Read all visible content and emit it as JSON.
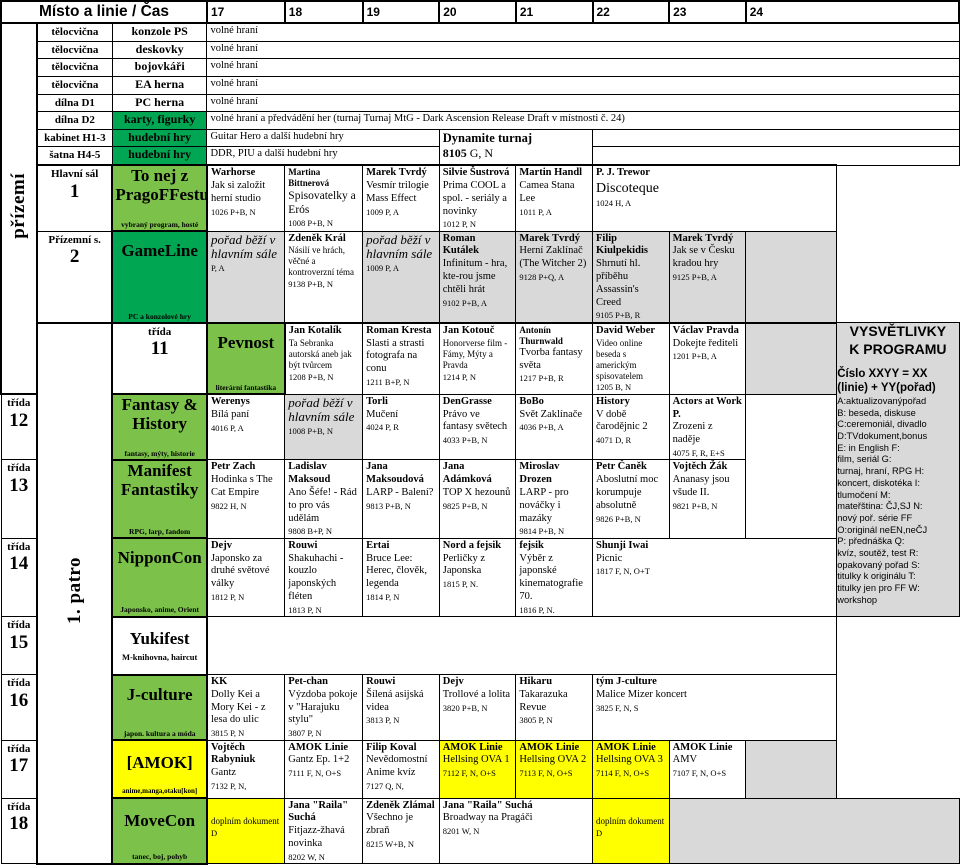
{
  "header": {
    "title": "Místo a linie / Čas",
    "times": [
      "17",
      "18",
      "19",
      "20",
      "21",
      "22",
      "23",
      "24"
    ]
  },
  "side_labels": {
    "ground": "přízemí",
    "floor1": "1. patro"
  },
  "free_play": "volné hraní",
  "rows": [
    {
      "place": "tělocvična",
      "line": "konzole PS",
      "line_color": "white",
      "text": "volné hraní"
    },
    {
      "place": "tělocvična",
      "line": "deskovky",
      "line_color": "white",
      "text": "volné hraní"
    },
    {
      "place": "tělocvična",
      "line": "bojovkáři",
      "line_color": "white",
      "text": "volné hraní"
    },
    {
      "place": "tělocvična",
      "line": "EA herna",
      "line_color": "white",
      "text": "volné hraní"
    },
    {
      "place": "dílna D1",
      "line": "PC herna",
      "line_color": "white",
      "text": "volné hraní"
    },
    {
      "place": "dílna D2",
      "line": "karty, figurky",
      "line_color": "green-dark",
      "text": "volné hraní a předvádění her (turnaj Turnaj MtG - Dark Ascension Release Draft v místnosti č. 24)"
    },
    {
      "place": "kabinet H1-3",
      "line": "hudební hry",
      "line_color": "green-dark",
      "text": "Guitar Hero a další hudební hry"
    },
    {
      "place": "šatna H4-5",
      "line": "hudební hry",
      "line_color": "green-dark",
      "text": "DDR, PIU a další hudební hry"
    }
  ],
  "dynamite": {
    "title": "Dynamite turnaj",
    "code": "8105",
    "rest": " G, N"
  },
  "main_hall": {
    "place": "Hlavní sál",
    "number": "1",
    "line_name_1": "To nej z",
    "line_name_2": "PragoFFestu",
    "line_sub": "vybraný program, hosté",
    "cells": [
      {
        "author": "Warhorse",
        "title": "Jak si založit herní studio",
        "code": "1026 P+B, N"
      },
      {
        "author": "Martina Bittnerová",
        "title": "Spisovatelky a Erós",
        "code": "1008 P+B, N",
        "author_small": true
      },
      {
        "author": "Marek Tvrdý",
        "title": "Vesmír trilogie Mass Effect",
        "code": "1009 P, A"
      },
      {
        "author": "Silvie Šustrová",
        "title": "Prima COOL a spol. - seriály a novinky",
        "code": "1012 P, N"
      },
      {
        "author": "Martin Handl",
        "title": "Camea Stana Lee",
        "code": "1011 P, A"
      },
      {
        "author": "P. J. Trewor",
        "title": "Discoteque",
        "code": "1024 H, A",
        "span": 3,
        "title_large": true
      }
    ]
  },
  "gameline": {
    "place": "Přízemní s.",
    "number": "2",
    "line_name": "GameLine",
    "line_sub": "PC a konzolové hry",
    "cells": [
      {
        "running": true,
        "title": "pořad běží v hlavním sále",
        "code": "P, A"
      },
      {
        "author": "Zdeněk Král",
        "title": "Násilí ve hrách, věčné a kontroverzní téma",
        "code": "9138 P+B, N",
        "author_small": true,
        "title_small": true
      },
      {
        "running": true,
        "title": "pořad běží v hlavním sále",
        "code": "1009 P, A"
      },
      {
        "author": "Roman Kutálek",
        "title": "Infinitum - hra, kte-rou jsme chtěli hrát",
        "code": "9102 P+B, A"
      },
      {
        "author": "Marek Tvrdý",
        "title": "Herní Zaklínač (The Witcher 2)",
        "code": "9128 P+Q, A"
      },
      {
        "author": "Filip Kiulpekidis",
        "title": "Shrnutí hl. příběhu Assassin's Creed",
        "code": "9105 P+B, R"
      },
      {
        "author": "Marek Tvrdý",
        "title": "Jak se v Česku kradou hry",
        "code": "9125 P+B, A"
      },
      {
        "grey": true
      }
    ]
  },
  "classes": [
    {
      "place": "třída",
      "number": "11",
      "line_name": "Pevnost",
      "line_sub": "literární fantastika",
      "line_color": "green-light",
      "cells": [
        {
          "author": "Jan Kotalík",
          "title": "Ta Sebranka autorská aneb jak být tvůrcem",
          "code": "1208 P+B, N",
          "title_small": true
        },
        {
          "author": "Roman Kresta",
          "title": "Slasti a strasti fotografa na conu",
          "code": "1211 B+P, N"
        },
        {
          "author": "Jan Kotouč",
          "title": "Honorverse film - Fámy, Mýty a Pravda",
          "code": "1214 P, N",
          "title_small": true
        },
        {
          "author": "Antonín Thurnwald",
          "title": "Tvorba fantasy světa",
          "code": "1217 P+B, R",
          "author_small": true
        },
        {
          "author": "David Weber",
          "title": "Video online beseda s americkým spisovatelem",
          "code": "1205 B, N",
          "title_small": true
        },
        {
          "author": "Václav Pravda",
          "title": "Dokejte řediteli",
          "code": "1201 P+B, A"
        },
        {
          "grey": true
        }
      ]
    },
    {
      "place": "třída",
      "number": "12",
      "line_name_1": "Fantasy &",
      "line_name_2": "History",
      "line_sub": "fantasy, mýty, historie",
      "line_color": "green-light",
      "cells": [
        {
          "author": "Werenys",
          "title": "Bílá paní",
          "code": "4016 P, A"
        },
        {
          "running": true,
          "title": "pořad běží v hlavním sále",
          "code": "1008 P+B, N"
        },
        {
          "author": "Torli",
          "title": "Mučení",
          "code": "4024 P, R"
        },
        {
          "author": "DenGrasse",
          "title": "Právo ve fantasy světech",
          "code": "4033 P+B, N"
        },
        {
          "author": "BoBo",
          "title": "Svět Zaklínače",
          "code": "4036 P+B, A"
        },
        {
          "author": "History",
          "title": "V době čarodějnic 2",
          "code": "4071 D, R"
        },
        {
          "author": "Actors at Work P.",
          "title": "Zrozeni z naděje",
          "code": "4075 F, R, E+S"
        },
        {
          "grey": true
        }
      ]
    },
    {
      "place": "třída",
      "number": "13",
      "line_name_1": "Manifest",
      "line_name_2": "Fantastiky",
      "line_sub": "RPG, larp, fandom",
      "line_color": "green-light",
      "cells": [
        {
          "author": "Petr Zach",
          "title": "Hodinka s The Cat Empire",
          "code": "9822 H, N"
        },
        {
          "author": "Ladislav Maksoud",
          "title": "Ano Šéfe! - Rád to pro vás udělám",
          "code": "9808 B+P, N"
        },
        {
          "author": "Jana Maksoudová",
          "title": "LARP - Balení?",
          "code": "9813 P+B, N"
        },
        {
          "author": "Jana Adámková",
          "title": "TOP X hezounů",
          "code": "9825 P+B, N"
        },
        {
          "author": "Miroslav Drozen",
          "title": "LARP - pro nováčky i mazáky",
          "code": "9814 P+B, N"
        },
        {
          "author": "Petr Čaněk",
          "title": "Aboslutní moc korumpuje absolutně",
          "code": "9826 P+B, N"
        },
        {
          "author": "Vojtěch Žák",
          "title": "Ananasy jsou všude II.",
          "code": "9821 P+B, N"
        },
        {
          "grey": true
        }
      ]
    },
    {
      "place": "třída",
      "number": "14",
      "line_name": "NipponCon",
      "line_sub": "Japonsko, anime, Orient",
      "line_color": "green-light",
      "cells": [
        {
          "author": "Dejv",
          "title": "Japonsko za druhé světové války",
          "code": "1812 P, N"
        },
        {
          "author": "Rouwi",
          "title": "Shakuhachi - kouzlo japonských fléten",
          "code": "1813 P, N"
        },
        {
          "author": "Ertai",
          "title": "Bruce Lee: Herec, člověk, legenda",
          "code": "1814 P, N"
        },
        {
          "author": "Nord a fejsik",
          "title": "Perličky z Japonska",
          "code": "1815 P, N."
        },
        {
          "author": "fejsik",
          "title": "Výběr z japonské kinematografie 70.",
          "code": "1816 P, N."
        },
        {
          "author": "Shunji Iwai",
          "title": "Picnic",
          "code": "1817 F, N, O+T",
          "span": 3
        }
      ]
    },
    {
      "place": "třída",
      "number": "15",
      "line_name": "Yukifest",
      "line_sub": "M-knihovna, haircut",
      "line_color": "white",
      "cells": [
        {
          "empty": true,
          "span": 8
        }
      ]
    },
    {
      "place": "třída",
      "number": "16",
      "line_name": "J-culture",
      "line_sub": "japon. kultura a móda",
      "line_color": "green-light",
      "cells": [
        {
          "author": "KK",
          "title": "Dolly Kei a Mory Kei - z lesa do ulic",
          "code": "3815 P, N"
        },
        {
          "author": "Pet-chan",
          "title": "Výzdoba pokoje v \"Harajuku stylu\"",
          "code": "3807 P, N"
        },
        {
          "author": "Rouwi",
          "title": "Šílená asijská videa",
          "code": "3813 P, N"
        },
        {
          "author": "Dejv",
          "title": "Trollové a lolita",
          "code": "3820 P+B, N"
        },
        {
          "author": "Hikaru",
          "title": "Takarazuka Revue",
          "code": "3805 P, N"
        },
        {
          "author": "tým J-culture",
          "title": "Malice Mizer koncert",
          "code": "3825 F, N, S",
          "span": 3
        }
      ]
    },
    {
      "place": "třída",
      "number": "17",
      "line_name": "[AMOK]",
      "line_sub": "anime,manga,otaku[kon]",
      "line_color": "yellow",
      "cells": [
        {
          "author": "Vojtěch Rabyniuk",
          "title": "Gantz",
          "code": "7132 P, N,"
        },
        {
          "author": "AMOK Linie",
          "title": "Gantz Ep. 1+2",
          "code": "7111 F, N, O+S"
        },
        {
          "author": "Filip Koval",
          "title": "Nevědomostní Anime kvíz",
          "code": "7127 Q, N,"
        },
        {
          "author": "AMOK Linie",
          "title": "Hellsing OVA 1",
          "code": "7112 F, N, O+S",
          "yellow": true
        },
        {
          "author": "AMOK Linie",
          "title": "Hellsing OVA 2",
          "code": "7113 F, N, O+S",
          "yellow": true
        },
        {
          "author": "AMOK Linie",
          "title": "Hellsing OVA 3",
          "code": "7114 F, N, O+S",
          "yellow": true
        },
        {
          "author": "AMOK Linie",
          "title": "AMV",
          "code": "7107 F, N, O+S"
        },
        {
          "grey": true
        }
      ]
    },
    {
      "place": "třída",
      "number": "18",
      "line_name": "MoveCon",
      "line_sub": "tanec, boj, pohyb",
      "line_color": "green-light",
      "cells": [
        {
          "yellow": true,
          "title": "doplním dokument",
          "code": "D",
          "title_small": true
        },
        {
          "author": "Jana \"Raila\" Suchá",
          "title": "Fitjazz-žhavá novinka",
          "code": "8202 W, N"
        },
        {
          "author": "Zdeněk Zlámal",
          "title": "Všechno je zbraň",
          "code": "8215 W+B, N"
        },
        {
          "author": "Jana \"Raila\" Suchá",
          "title": "Broadway na Pragáči",
          "code": "8201 W, N",
          "span": 2
        },
        {
          "yellow": true,
          "title": "doplním dokument",
          "code": "D",
          "title_small": true
        },
        {
          "grey": true,
          "span": 2
        }
      ]
    }
  ],
  "legend": {
    "title_line1": "VYSVĚTLIVKY",
    "title_line2": "K PROGRAMU",
    "key_line1": "Číslo XXYY = XX",
    "key_line2": "(linie) + YY(pořad)",
    "entries": [
      "A:aktualizovanýpořad",
      "B: beseda, diskuse",
      "C:ceremoniál, divadlo",
      "D:TVdokument,bonus",
      "E: in English            F:",
      "film, seriál              G:",
      "turnaj, hraní, RPG  H:",
      "koncert, diskotéka      I:",
      "tlumočení                M:",
      "mateřština: ČJ,SJ   N:",
      "nový poř. série FF",
      "O:originál neEN,neČJ",
      "P: přednáška           Q:",
      "kvíz, soutěž, test      R:",
      "opakovaný pořad     S:",
      "titulky k originálu      T:",
      "titulky jen pro FF     W:",
      "workshop"
    ]
  }
}
